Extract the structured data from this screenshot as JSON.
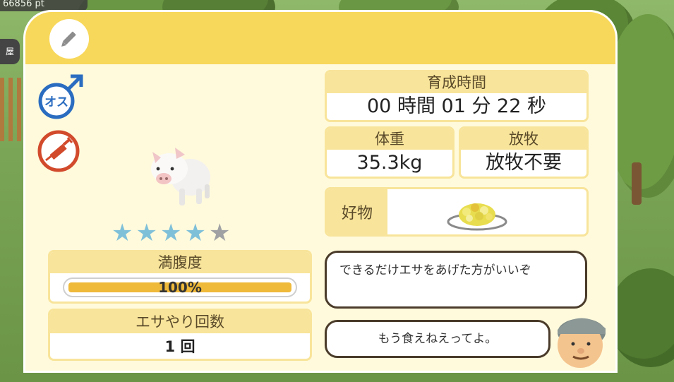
{
  "background": {
    "points_text": "66856 pt",
    "side_button_label": "屋"
  },
  "panel": {
    "edit_icon": "pencil-icon",
    "gender_icon": "male-icon",
    "gender_label": "オス",
    "vaccine_icon": "syringe-icon",
    "rating": {
      "value": 4,
      "max": 5
    },
    "fullness": {
      "label": "満腹度",
      "value_text": "100%",
      "fraction": 1.0
    },
    "feed_count": {
      "label": "エサやり回数",
      "value": "1 回"
    },
    "growth_time": {
      "label": "育成時間",
      "value": "00 時間 01 分 22 秒"
    },
    "weight": {
      "label": "体重",
      "value": "35.3kg"
    },
    "grazing": {
      "label": "放牧",
      "value": "放牧不要"
    },
    "favorite": {
      "label": "好物",
      "food_icon": "corn-feed-icon"
    },
    "speech": [
      {
        "text": "できるだけエサをあげた方がいいぞ"
      },
      {
        "text": "もう食えねえってよ。"
      }
    ]
  },
  "colors": {
    "header": "#f8d85a",
    "panel_bg": "#fffadc",
    "box_head": "#f8e49a",
    "star_on": "#7fc0d9",
    "star_off": "#9fa1a3",
    "gauge_fill": "#efb93a",
    "male_blue": "#2a6cc0",
    "vaccine_red": "#d24a2c"
  }
}
